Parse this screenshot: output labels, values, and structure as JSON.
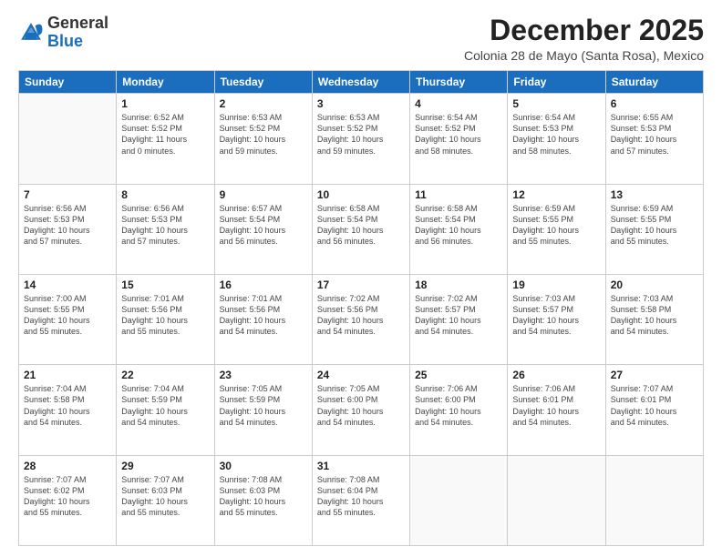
{
  "header": {
    "logo_general": "General",
    "logo_blue": "Blue",
    "month_title": "December 2025",
    "subtitle": "Colonia 28 de Mayo (Santa Rosa), Mexico"
  },
  "weekdays": [
    "Sunday",
    "Monday",
    "Tuesday",
    "Wednesday",
    "Thursday",
    "Friday",
    "Saturday"
  ],
  "weeks": [
    [
      {
        "day": "",
        "info": ""
      },
      {
        "day": "1",
        "info": "Sunrise: 6:52 AM\nSunset: 5:52 PM\nDaylight: 11 hours\nand 0 minutes."
      },
      {
        "day": "2",
        "info": "Sunrise: 6:53 AM\nSunset: 5:52 PM\nDaylight: 10 hours\nand 59 minutes."
      },
      {
        "day": "3",
        "info": "Sunrise: 6:53 AM\nSunset: 5:52 PM\nDaylight: 10 hours\nand 59 minutes."
      },
      {
        "day": "4",
        "info": "Sunrise: 6:54 AM\nSunset: 5:52 PM\nDaylight: 10 hours\nand 58 minutes."
      },
      {
        "day": "5",
        "info": "Sunrise: 6:54 AM\nSunset: 5:53 PM\nDaylight: 10 hours\nand 58 minutes."
      },
      {
        "day": "6",
        "info": "Sunrise: 6:55 AM\nSunset: 5:53 PM\nDaylight: 10 hours\nand 57 minutes."
      }
    ],
    [
      {
        "day": "7",
        "info": "Sunrise: 6:56 AM\nSunset: 5:53 PM\nDaylight: 10 hours\nand 57 minutes."
      },
      {
        "day": "8",
        "info": "Sunrise: 6:56 AM\nSunset: 5:53 PM\nDaylight: 10 hours\nand 57 minutes."
      },
      {
        "day": "9",
        "info": "Sunrise: 6:57 AM\nSunset: 5:54 PM\nDaylight: 10 hours\nand 56 minutes."
      },
      {
        "day": "10",
        "info": "Sunrise: 6:58 AM\nSunset: 5:54 PM\nDaylight: 10 hours\nand 56 minutes."
      },
      {
        "day": "11",
        "info": "Sunrise: 6:58 AM\nSunset: 5:54 PM\nDaylight: 10 hours\nand 56 minutes."
      },
      {
        "day": "12",
        "info": "Sunrise: 6:59 AM\nSunset: 5:55 PM\nDaylight: 10 hours\nand 55 minutes."
      },
      {
        "day": "13",
        "info": "Sunrise: 6:59 AM\nSunset: 5:55 PM\nDaylight: 10 hours\nand 55 minutes."
      }
    ],
    [
      {
        "day": "14",
        "info": "Sunrise: 7:00 AM\nSunset: 5:55 PM\nDaylight: 10 hours\nand 55 minutes."
      },
      {
        "day": "15",
        "info": "Sunrise: 7:01 AM\nSunset: 5:56 PM\nDaylight: 10 hours\nand 55 minutes."
      },
      {
        "day": "16",
        "info": "Sunrise: 7:01 AM\nSunset: 5:56 PM\nDaylight: 10 hours\nand 54 minutes."
      },
      {
        "day": "17",
        "info": "Sunrise: 7:02 AM\nSunset: 5:56 PM\nDaylight: 10 hours\nand 54 minutes."
      },
      {
        "day": "18",
        "info": "Sunrise: 7:02 AM\nSunset: 5:57 PM\nDaylight: 10 hours\nand 54 minutes."
      },
      {
        "day": "19",
        "info": "Sunrise: 7:03 AM\nSunset: 5:57 PM\nDaylight: 10 hours\nand 54 minutes."
      },
      {
        "day": "20",
        "info": "Sunrise: 7:03 AM\nSunset: 5:58 PM\nDaylight: 10 hours\nand 54 minutes."
      }
    ],
    [
      {
        "day": "21",
        "info": "Sunrise: 7:04 AM\nSunset: 5:58 PM\nDaylight: 10 hours\nand 54 minutes."
      },
      {
        "day": "22",
        "info": "Sunrise: 7:04 AM\nSunset: 5:59 PM\nDaylight: 10 hours\nand 54 minutes."
      },
      {
        "day": "23",
        "info": "Sunrise: 7:05 AM\nSunset: 5:59 PM\nDaylight: 10 hours\nand 54 minutes."
      },
      {
        "day": "24",
        "info": "Sunrise: 7:05 AM\nSunset: 6:00 PM\nDaylight: 10 hours\nand 54 minutes."
      },
      {
        "day": "25",
        "info": "Sunrise: 7:06 AM\nSunset: 6:00 PM\nDaylight: 10 hours\nand 54 minutes."
      },
      {
        "day": "26",
        "info": "Sunrise: 7:06 AM\nSunset: 6:01 PM\nDaylight: 10 hours\nand 54 minutes."
      },
      {
        "day": "27",
        "info": "Sunrise: 7:07 AM\nSunset: 6:01 PM\nDaylight: 10 hours\nand 54 minutes."
      }
    ],
    [
      {
        "day": "28",
        "info": "Sunrise: 7:07 AM\nSunset: 6:02 PM\nDaylight: 10 hours\nand 55 minutes."
      },
      {
        "day": "29",
        "info": "Sunrise: 7:07 AM\nSunset: 6:03 PM\nDaylight: 10 hours\nand 55 minutes."
      },
      {
        "day": "30",
        "info": "Sunrise: 7:08 AM\nSunset: 6:03 PM\nDaylight: 10 hours\nand 55 minutes."
      },
      {
        "day": "31",
        "info": "Sunrise: 7:08 AM\nSunset: 6:04 PM\nDaylight: 10 hours\nand 55 minutes."
      },
      {
        "day": "",
        "info": ""
      },
      {
        "day": "",
        "info": ""
      },
      {
        "day": "",
        "info": ""
      }
    ]
  ]
}
